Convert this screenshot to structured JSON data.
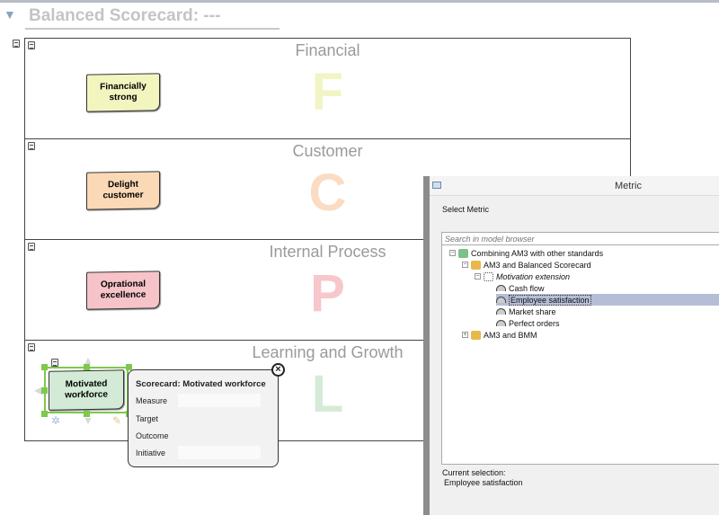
{
  "header": {
    "title": "Balanced Scorecard: ---"
  },
  "lanes": [
    {
      "title": "Financial",
      "letter": "F",
      "letter_color": "#f2f4c6",
      "note": {
        "text": "Financially strong",
        "color": "#f3f5bf"
      }
    },
    {
      "title": "Customer",
      "letter": "C",
      "letter_color": "#fbdcc2",
      "note": {
        "text": "Delight customer",
        "color": "#fbd9b6"
      }
    },
    {
      "title": "Internal Process",
      "letter": "P",
      "letter_color": "#f7c7cb",
      "note": {
        "text": "Oprational excellence",
        "color": "#f6c3c8"
      }
    },
    {
      "title": "Learning and Growth",
      "letter": "L",
      "letter_color": "#d5ebd7",
      "note": {
        "text": "Motivated workforce",
        "color": "#d3ebd6"
      }
    }
  ],
  "popup": {
    "title": "Scorecard: Motivated workforce",
    "fields": [
      "Measure",
      "Target",
      "Outcome",
      "Initiative"
    ]
  },
  "dialog": {
    "title": "Metric",
    "label": "Select Metric",
    "search_placeholder": "Search in model browser",
    "tree": [
      {
        "label": "Combining AM3 with other standards",
        "toggle": "−"
      },
      {
        "label": "AM3 and Balanced Scorecard",
        "toggle": "−"
      },
      {
        "label": "Motivation extension",
        "toggle": "−"
      },
      {
        "label": "Cash flow"
      },
      {
        "label": "Employee satisfaction",
        "selected": true
      },
      {
        "label": "Market share"
      },
      {
        "label": "Perfect orders"
      },
      {
        "label": "AM3 and BMM",
        "toggle": "+"
      }
    ],
    "current_selection_label": "Current selection:",
    "current_selection_value": "Employee satisfaction"
  },
  "colors": {
    "selection_handles": "#7ec84c",
    "tree_selection": "#b6bdd6"
  }
}
